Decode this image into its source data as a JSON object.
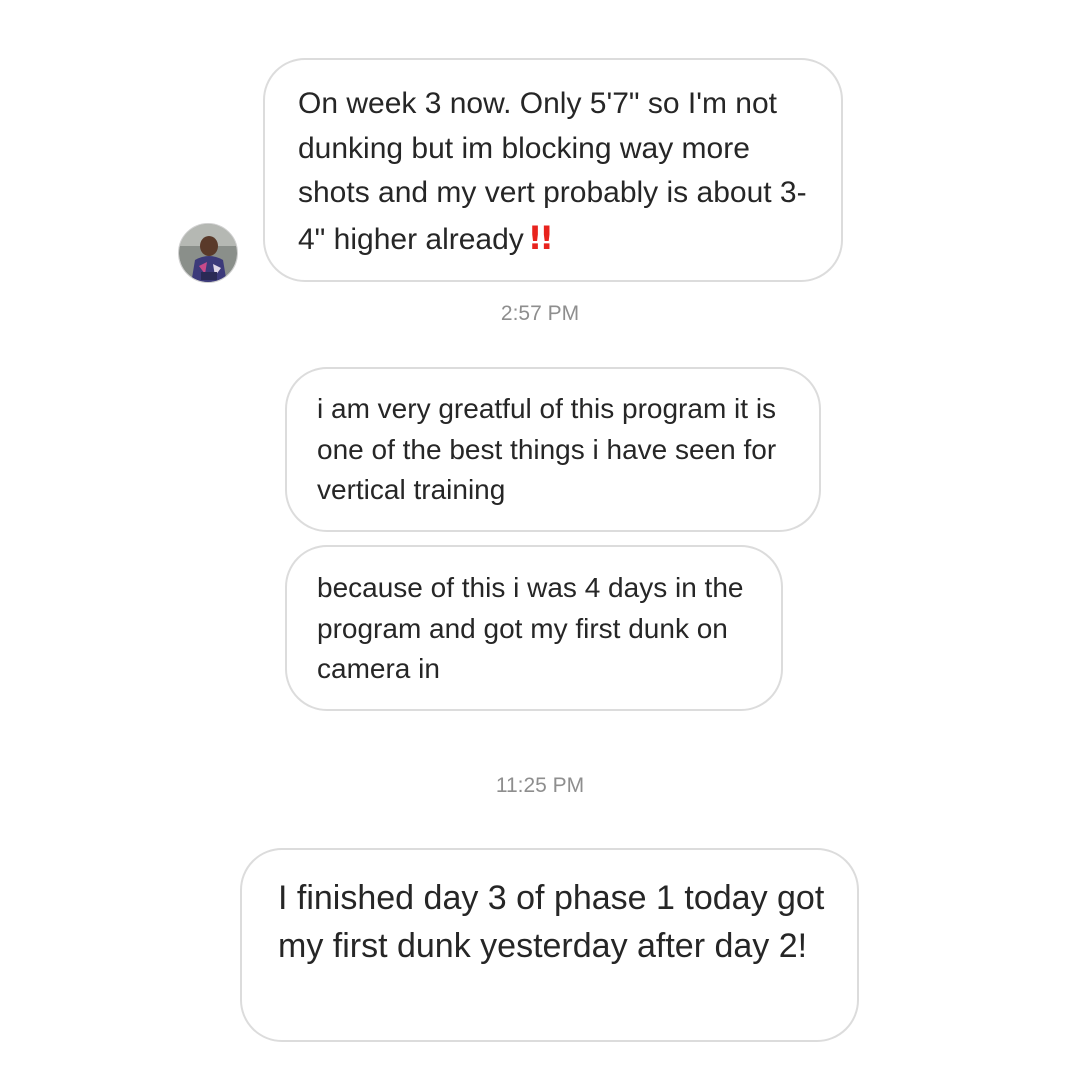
{
  "messages": [
    {
      "text": "On week 3 now. Only 5'7\" so I'm not dunking but im blocking way more shots and my vert probably is about 3-4\" higher already",
      "emoji": "‼️",
      "emoji_glyph": "!!"
    },
    {
      "text": "i am very greatful of this program it is one of the best things i have seen for vertical training"
    },
    {
      "text": "because of this i was 4 days in the program and got my first dunk on camera in"
    },
    {
      "text": "I finished day 3 of phase 1 today got my first dunk yesterday after day 2!"
    }
  ],
  "timestamps": [
    "2:57 PM",
    "11:25 PM"
  ],
  "avatar": {
    "icon": "user-photo-avatar"
  },
  "colors": {
    "background": "#ffffff",
    "bubble_border": "#dcdcdc",
    "text": "#262626",
    "timestamp": "#8e8e8e",
    "emoji_red": "#e8231d"
  }
}
